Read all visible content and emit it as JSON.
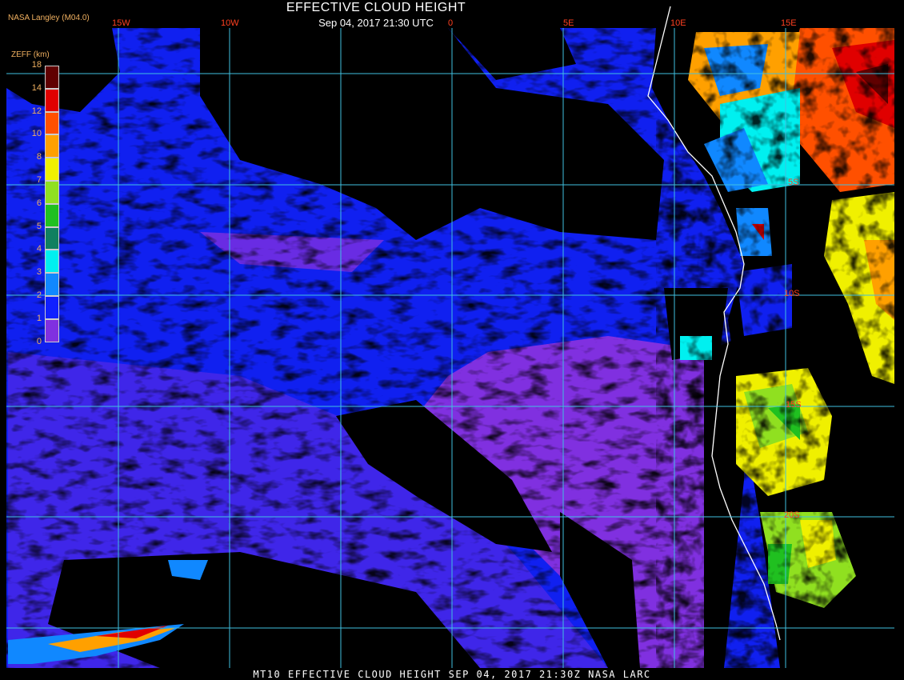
{
  "title": "EFFECTIVE CLOUD HEIGHT",
  "subtitle": "Sep 04, 2017 21:30 UTC",
  "credit": "NASA Langley (M04.0)",
  "footer": "MT10  EFFECTIVE CLOUD HEIGHT   SEP 04, 2017 21:30Z   NASA LARC",
  "lon_labels": [
    "15W",
    "10W",
    "0",
    "5E",
    "10E",
    "15E"
  ],
  "lat_labels": [
    "5S",
    "10S",
    "15S",
    "20S"
  ],
  "colorbar": {
    "title": "ZEFF (km)",
    "ticks": [
      "18",
      "14",
      "12",
      "10",
      "8",
      "7",
      "6",
      "5",
      "4",
      "3",
      "2",
      "1",
      "0"
    ],
    "colors": [
      "#600000",
      "#e00000",
      "#ff5000",
      "#ffa000",
      "#f0f000",
      "#90e020",
      "#20c020",
      "#108060",
      "#00f0f0",
      "#1088ff",
      "#1020ff",
      "#8030e0"
    ]
  },
  "palette": {
    "background": "#000000",
    "grid": "#40c0e0",
    "coast": "#ffffff"
  }
}
